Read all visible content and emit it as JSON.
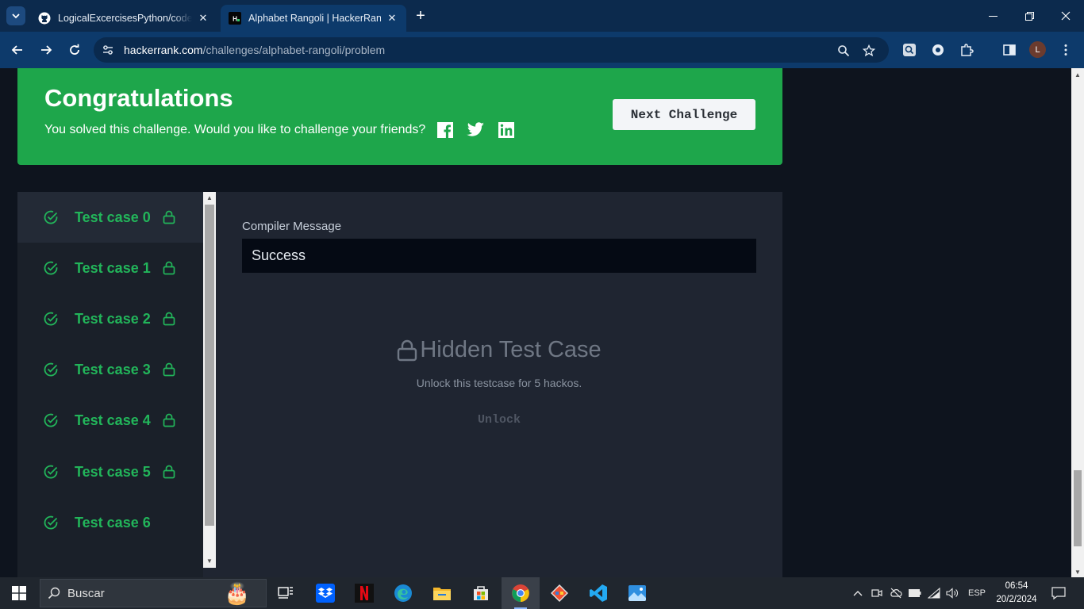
{
  "browser": {
    "tabs": [
      {
        "title": "LogicalExcercisesPython/codeSi",
        "icon": "github-icon",
        "active": false
      },
      {
        "title": "Alphabet Rangoli | HackerRank",
        "icon": "hackerrank-icon",
        "active": true
      }
    ],
    "url_domain": "hackerrank.com",
    "url_path": "/challenges/alphabet-rangoli/problem",
    "profile_initial": "L"
  },
  "banner": {
    "title": "Congratulations",
    "message": "You solved this challenge. Would you like to challenge your friends?",
    "social": [
      "facebook-icon",
      "twitter-icon",
      "linkedin-icon"
    ],
    "next_button": "Next Challenge",
    "color": "#1ea64b"
  },
  "test_cases": [
    {
      "label": "Test case 0",
      "passed": true,
      "locked": true,
      "selected": true
    },
    {
      "label": "Test case 1",
      "passed": true,
      "locked": true,
      "selected": false
    },
    {
      "label": "Test case 2",
      "passed": true,
      "locked": true,
      "selected": false
    },
    {
      "label": "Test case 3",
      "passed": true,
      "locked": true,
      "selected": false
    },
    {
      "label": "Test case 4",
      "passed": true,
      "locked": true,
      "selected": false
    },
    {
      "label": "Test case 5",
      "passed": true,
      "locked": true,
      "selected": false
    },
    {
      "label": "Test case 6",
      "passed": true,
      "locked": false,
      "selected": false
    }
  ],
  "detail": {
    "compiler_label": "Compiler Message",
    "compiler_value": "Success",
    "hidden_title": "Hidden Test Case",
    "hidden_subtitle": "Unlock this testcase for 5 hackos.",
    "unlock_button": "Unlock"
  },
  "taskbar": {
    "search_placeholder": "Buscar",
    "language": "ESP",
    "time": "06:54",
    "date": "20/2/2024",
    "apps": [
      "task-view-icon",
      "dropbox-icon",
      "netflix-icon",
      "edge-icon",
      "file-explorer-icon",
      "store-icon",
      "chrome-icon",
      "git-icon",
      "vscode-icon",
      "photos-icon"
    ]
  },
  "colors": {
    "accent_green": "#22b55a",
    "page_bg": "#0e141e",
    "panel_bg": "#1f2531"
  }
}
